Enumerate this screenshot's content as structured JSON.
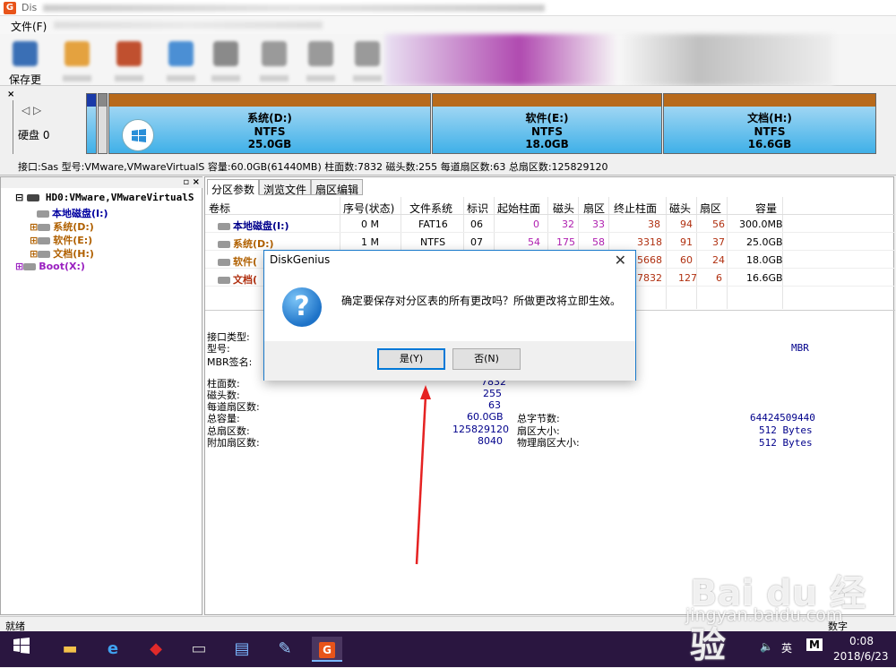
{
  "window": {
    "title": "Dis",
    "menu": [
      "文件(F)"
    ],
    "toolbar_first_label": "保存更"
  },
  "diskmap": {
    "disk_label": "硬盘 0",
    "partitions": [
      {
        "name": "系统(D:)",
        "fs": "NTFS",
        "size": "25.0GB"
      },
      {
        "name": "软件(E:)",
        "fs": "NTFS",
        "size": "18.0GB"
      },
      {
        "name": "文档(H:)",
        "fs": "NTFS",
        "size": "16.6GB"
      }
    ],
    "info": "接口:Sas  型号:VMware,VMwareVirtualS  容量:60.0GB(61440MB)  柱面数:7832  磁头数:255  每道扇区数:63  总扇区数:125829120"
  },
  "tree": {
    "disk": "HD0:VMware,VMwareVirtualS",
    "items": [
      "本地磁盘(I:)",
      "系统(D:)",
      "软件(E:)",
      "文档(H:)",
      "Boot(X:)"
    ]
  },
  "tabs": [
    "分区参数",
    "浏览文件",
    "扇区编辑"
  ],
  "grid": {
    "headers": [
      "卷标",
      "序号(状态)",
      "文件系统",
      "标识",
      "起始柱面",
      "磁头",
      "扇区",
      "终止柱面",
      "磁头",
      "扇区",
      "容量"
    ],
    "rows": [
      {
        "label": "本地磁盘(I:)",
        "index": "0 M",
        "fs": "FAT16",
        "id": "06",
        "sc": "0",
        "sh": "32",
        "ss": "33",
        "ec": "38",
        "eh": "94",
        "es": "56",
        "cap": "300.0MB"
      },
      {
        "label": "系统(D:)",
        "index": "1 M",
        "fs": "NTFS",
        "id": "07",
        "sc": "54",
        "sh": "175",
        "ss": "58",
        "ec": "3318",
        "eh": "91",
        "es": "37",
        "cap": "25.0GB"
      },
      {
        "label": "软件(",
        "index": "",
        "fs": "",
        "id": "",
        "sc": "",
        "sh": "",
        "ss": "",
        "ec": "5668",
        "eh": "60",
        "es": "24",
        "cap": "18.0GB"
      },
      {
        "label": "文档(",
        "index": "",
        "fs": "",
        "id": "",
        "sc": "",
        "sh": "",
        "ss": "",
        "ec": "7832",
        "eh": "127",
        "es": "6",
        "cap": "16.6GB"
      }
    ]
  },
  "details": {
    "iface_type_label": "接口类型:",
    "model_label": "型号:",
    "mbr_sig_label": "MBR签名:",
    "partition_style": "MBR",
    "cyl_label": "柱面数:",
    "cyl_val": "7832",
    "heads_label": "磁头数:",
    "heads_val": "255",
    "spt_label": "每道扇区数:",
    "spt_val": "63",
    "cap_label": "总容量:",
    "cap_val": "60.0GB",
    "sectors_label": "总扇区数:",
    "sectors_val": "125829120",
    "extra_label": "附加扇区数:",
    "extra_val": "8040",
    "bytes_label": "总字节数:",
    "bytes_val": "64424509440",
    "secsize_label": "扇区大小:",
    "secsize_val": "512 Bytes",
    "physsec_label": "物理扇区大小:",
    "physsec_val": "512 Bytes"
  },
  "status": {
    "left": "就绪",
    "right": "数字"
  },
  "dialog": {
    "title": "DiskGenius",
    "message": "确定要保存对分区表的所有更改吗？所做更改将立即生效。",
    "yes": "是(Y)",
    "no": "否(N)"
  },
  "taskbar": {
    "ime": "英",
    "ime2": "M",
    "time": "0:08",
    "date": "2018/6/23"
  },
  "watermark": {
    "brand": "Bai du 经验",
    "url": "jingyan.baidu.com"
  }
}
